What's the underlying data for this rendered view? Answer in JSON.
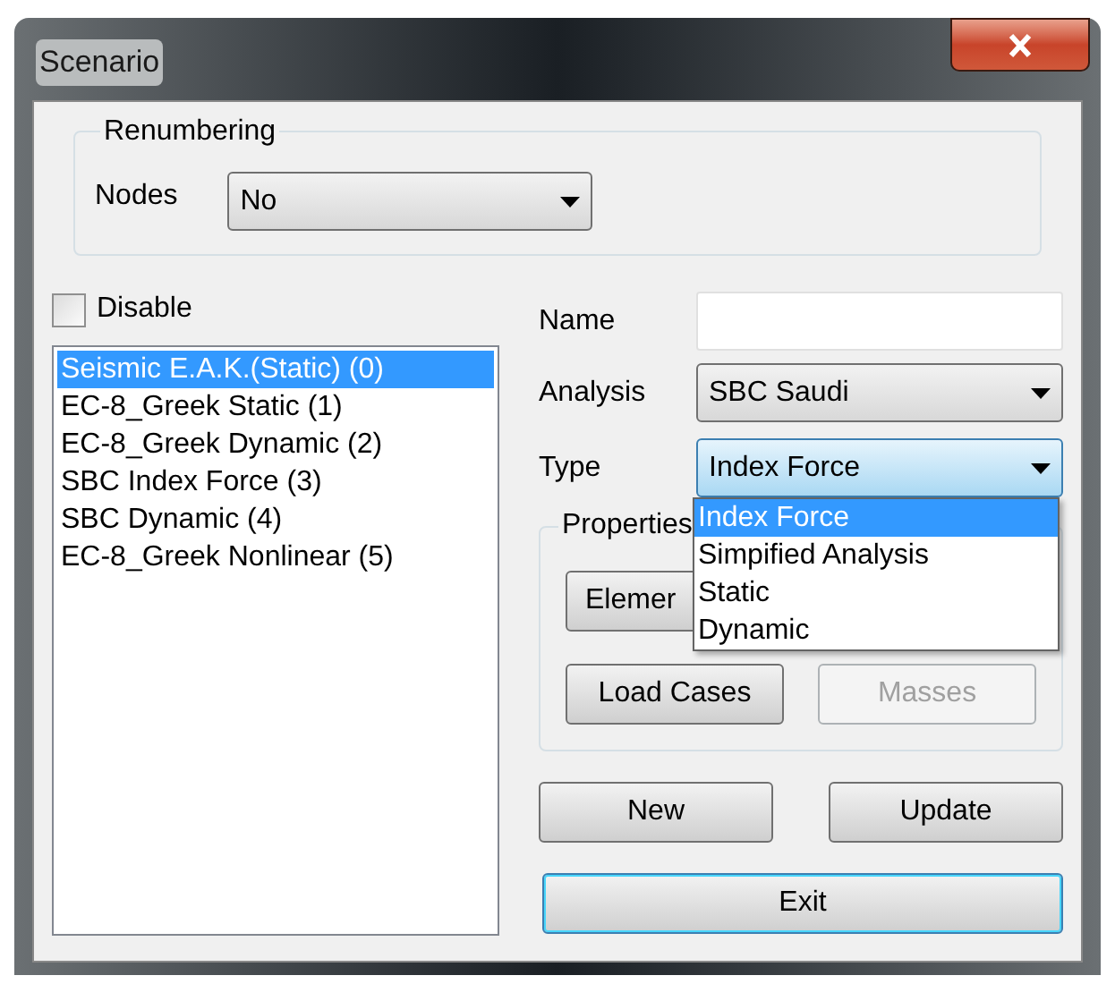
{
  "window": {
    "title": "Scenario"
  },
  "renumbering": {
    "title": "Renumbering",
    "nodes_label": "Nodes",
    "nodes_value": "No"
  },
  "disable": {
    "label": "Disable",
    "checked": false
  },
  "scenarios": [
    {
      "label": "Seismic E.A.K.(Static) (0)",
      "selected": true
    },
    {
      "label": "EC-8_Greek Static (1)",
      "selected": false
    },
    {
      "label": "EC-8_Greek Dynamic (2)",
      "selected": false
    },
    {
      "label": "SBC Index Force (3)",
      "selected": false
    },
    {
      "label": "SBC Dynamic (4)",
      "selected": false
    },
    {
      "label": "EC-8_Greek Nonlinear (5)",
      "selected": false
    }
  ],
  "name": {
    "label": "Name"
  },
  "analysis": {
    "label": "Analysis",
    "value": "SBC Saudi"
  },
  "type": {
    "label": "Type",
    "value": "Index Force",
    "expanded": true,
    "options": [
      {
        "label": "Index Force",
        "selected": true
      },
      {
        "label": "Simpified Analysis",
        "selected": false
      },
      {
        "label": "Static",
        "selected": false
      },
      {
        "label": "Dynamic",
        "selected": false
      }
    ]
  },
  "properties": {
    "title": "Properties",
    "buttons": [
      {
        "label": "Elemer",
        "disabled": false
      },
      {
        "label": "Load Cases",
        "disabled": false
      },
      {
        "label": "Masses",
        "disabled": true
      }
    ]
  },
  "buttons": [
    {
      "label": "New",
      "focused": false
    },
    {
      "label": "Update",
      "focused": false
    },
    {
      "label": "Exit",
      "focused": true
    }
  ]
}
